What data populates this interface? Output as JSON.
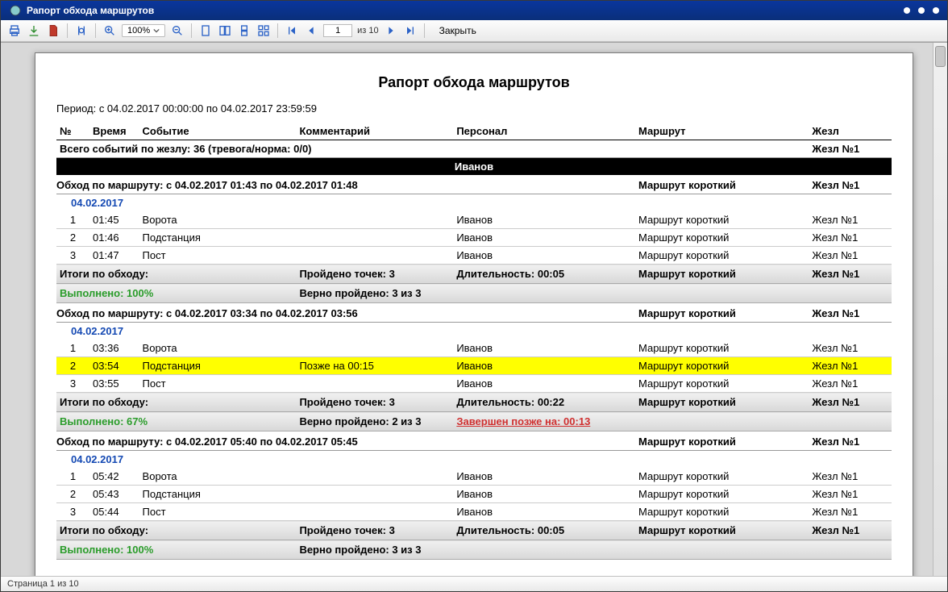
{
  "window": {
    "title": "Рапорт обхода маршрутов"
  },
  "toolbar": {
    "zoom": "100%",
    "page_current": "1",
    "page_total_label": "из 10",
    "close_label": "Закрыть"
  },
  "report": {
    "title": "Рапорт обхода маршрутов",
    "period": "Период: с 04.02.2017 00:00:00 по 04.02.2017 23:59:59"
  },
  "headers": {
    "num": "№",
    "time": "Время",
    "event": "Событие",
    "comment": "Комментарий",
    "person": "Персонал",
    "route": "Маршрут",
    "baton": "Жезл"
  },
  "summary_top": {
    "text": "Всего событий по жезлу: 36 (тревога/норма: 0/0)",
    "baton": "Жезл №1"
  },
  "person_band": "Иванов",
  "routes": [
    {
      "header": "Обход по маршруту: с 04.02.2017 01:43 по 04.02.2017 01:48",
      "route": "Маршрут короткий",
      "baton": "Жезл №1",
      "date": "04.02.2017",
      "rows": [
        {
          "n": "1",
          "t": "01:45",
          "event": "Ворота",
          "comment": "",
          "person": "Иванов",
          "route": "Маршрут короткий",
          "baton": "Жезл №1",
          "hl": false
        },
        {
          "n": "2",
          "t": "01:46",
          "event": "Подстанция",
          "comment": "",
          "person": "Иванов",
          "route": "Маршрут короткий",
          "baton": "Жезл №1",
          "hl": false
        },
        {
          "n": "3",
          "t": "01:47",
          "event": "Пост",
          "comment": "",
          "person": "Иванов",
          "route": "Маршрут короткий",
          "baton": "Жезл №1",
          "hl": false
        }
      ],
      "totals": {
        "a1": "Итоги по обходу:",
        "a2": "Выполнено: 100%",
        "b1": "Пройдено точек: 3",
        "b2": "Верно пройдено: 3 из 3",
        "c1": "Длительность: 00:05",
        "c2": "",
        "route": "Маршрут короткий",
        "baton": "Жезл №1",
        "a2_class": "green",
        "c2_class": ""
      }
    },
    {
      "header": "Обход по маршруту: с 04.02.2017 03:34 по 04.02.2017 03:56",
      "route": "Маршрут короткий",
      "baton": "Жезл №1",
      "date": "04.02.2017",
      "rows": [
        {
          "n": "1",
          "t": "03:36",
          "event": "Ворота",
          "comment": "",
          "person": "Иванов",
          "route": "Маршрут короткий",
          "baton": "Жезл №1",
          "hl": false
        },
        {
          "n": "2",
          "t": "03:54",
          "event": "Подстанция",
          "comment": "Позже на 00:15",
          "person": "Иванов",
          "route": "Маршрут короткий",
          "baton": "Жезл №1",
          "hl": true
        },
        {
          "n": "3",
          "t": "03:55",
          "event": "Пост",
          "comment": "",
          "person": "Иванов",
          "route": "Маршрут короткий",
          "baton": "Жезл №1",
          "hl": false
        }
      ],
      "totals": {
        "a1": "Итоги по обходу:",
        "a2": "Выполнено: 67%",
        "b1": "Пройдено точек: 3",
        "b2": "Верно пройдено: 2 из 3",
        "c1": "Длительность: 00:22",
        "c2": "Завершен позже на: 00:13",
        "route": "Маршрут короткий",
        "baton": "Жезл №1",
        "a2_class": "green",
        "c2_class": "red"
      }
    },
    {
      "header": "Обход по маршруту: с 04.02.2017 05:40 по 04.02.2017 05:45",
      "route": "Маршрут короткий",
      "baton": "Жезл №1",
      "date": "04.02.2017",
      "rows": [
        {
          "n": "1",
          "t": "05:42",
          "event": "Ворота",
          "comment": "",
          "person": "Иванов",
          "route": "Маршрут короткий",
          "baton": "Жезл №1",
          "hl": false
        },
        {
          "n": "2",
          "t": "05:43",
          "event": "Подстанция",
          "comment": "",
          "person": "Иванов",
          "route": "Маршрут короткий",
          "baton": "Жезл №1",
          "hl": false
        },
        {
          "n": "3",
          "t": "05:44",
          "event": "Пост",
          "comment": "",
          "person": "Иванов",
          "route": "Маршрут короткий",
          "baton": "Жезл №1",
          "hl": false
        }
      ],
      "totals": {
        "a1": "Итоги по обходу:",
        "a2": "Выполнено: 100%",
        "b1": "Пройдено точек: 3",
        "b2": "Верно пройдено: 3 из 3",
        "c1": "Длительность: 00:05",
        "c2": "",
        "route": "Маршрут короткий",
        "baton": "Жезл №1",
        "a2_class": "green",
        "c2_class": ""
      }
    }
  ],
  "status": "Страница 1 из 10"
}
